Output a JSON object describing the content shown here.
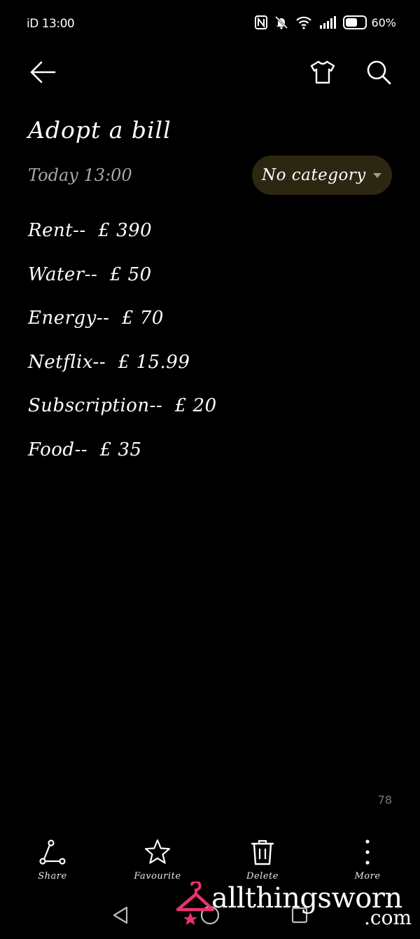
{
  "status_bar": {
    "time": "iD 13:00",
    "battery_pct": "60%",
    "battery_level": 0.6,
    "icons": [
      "nfc-icon",
      "bell-muted-icon",
      "wifi-icon",
      "signal-icon",
      "battery-icon"
    ]
  },
  "toolbar": {
    "icons": [
      "back-arrow-icon",
      "shirt-icon",
      "search-icon"
    ]
  },
  "note": {
    "title": "Adopt a bill",
    "timestamp": "Today 13:00",
    "category": "No category",
    "lines": [
      "Rent--  £ 390",
      "Water--  £ 50",
      "Energy--  £ 70",
      "Netflix--  £ 15.99",
      "Subscription--  £ 20",
      "Food--  £ 35"
    ],
    "word_count": "78"
  },
  "actions": {
    "share": "Share",
    "favourite": "Favourite",
    "delete": "Delete",
    "more": "More"
  },
  "watermark": {
    "text": "allthingsworn",
    "suffix": ".com",
    "accent": "#e8336e"
  },
  "colors": {
    "background": "#000000",
    "category_bg": "#2d2611",
    "muted_text": "#a9a9a9"
  }
}
